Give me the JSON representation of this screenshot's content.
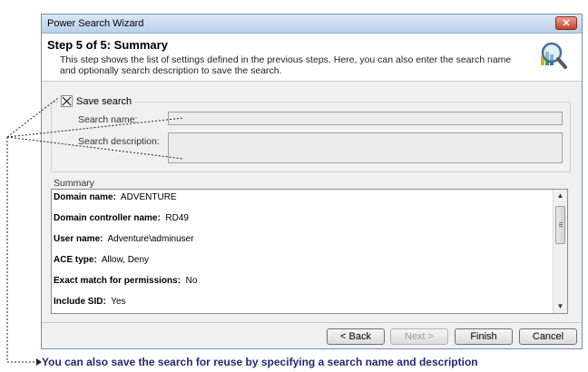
{
  "window": {
    "title": "Power Search Wizard",
    "close_glyph": "✕"
  },
  "header": {
    "step_title": "Step 5 of 5:  Summary",
    "description": "This step shows the list of settings defined in the previous steps. Here, you can also enter the search name and optionally search description to save the search."
  },
  "save_search": {
    "checkbox_label": "Save search",
    "checked": true,
    "name_label": "Search name:",
    "name_value": "",
    "description_label": "Search description:",
    "description_value": ""
  },
  "summary": {
    "label": "Summary",
    "rows": [
      {
        "key": "Domain name:",
        "value": "ADVENTURE"
      },
      {
        "key": "Domain controller name:",
        "value": "RD49"
      },
      {
        "key": "User name:",
        "value": "Adventure\\adminuser"
      },
      {
        "key": "ACE type:",
        "value": "Allow, Deny"
      },
      {
        "key": "Exact match for permissions:",
        "value": "No"
      },
      {
        "key": "Include SID:",
        "value": "Yes"
      }
    ]
  },
  "buttons": {
    "back": "< Back",
    "next": "Next >",
    "finish": "Finish",
    "cancel": "Cancel"
  },
  "caption": "You can also save the search for reuse by specifying a search name and description",
  "icons": {
    "wizard": "search-magnifier-chart-icon",
    "checkbox_mark": "x-mark"
  }
}
